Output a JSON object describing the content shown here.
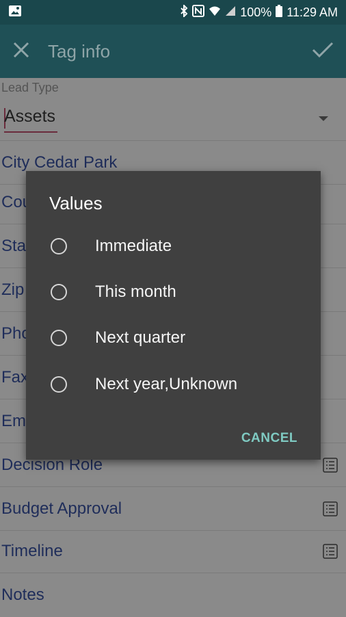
{
  "status_bar": {
    "battery": "100%",
    "time": "11:29 AM"
  },
  "toolbar": {
    "title": "Tag info",
    "close_icon": "close-icon",
    "confirm_icon": "check-icon"
  },
  "form": {
    "lead_type": {
      "label": "Lead Type",
      "value": "Assets"
    },
    "rows": [
      {
        "label": "City Cedar Park",
        "has_icon": false
      },
      {
        "label": "Cou",
        "has_icon": false
      },
      {
        "label": "Sta",
        "has_icon": false
      },
      {
        "label": "Zip",
        "has_icon": false
      },
      {
        "label": "Pho",
        "has_icon": false
      },
      {
        "label": "Fax",
        "has_icon": false
      },
      {
        "label": "Em",
        "has_icon": false
      },
      {
        "label": "Decision Role",
        "has_icon": true
      },
      {
        "label": "Budget Approval",
        "has_icon": true
      },
      {
        "label": "Timeline",
        "has_icon": true
      },
      {
        "label": "Notes",
        "has_icon": false
      }
    ]
  },
  "dialog": {
    "title": "Values",
    "options": [
      "Immediate",
      "This month",
      "Next quarter",
      "Next year,Unknown"
    ],
    "cancel_label": "CANCEL"
  },
  "colors": {
    "toolbar": "#1f5056",
    "dialog_bg": "#404040",
    "accent": "#7fcac2"
  }
}
